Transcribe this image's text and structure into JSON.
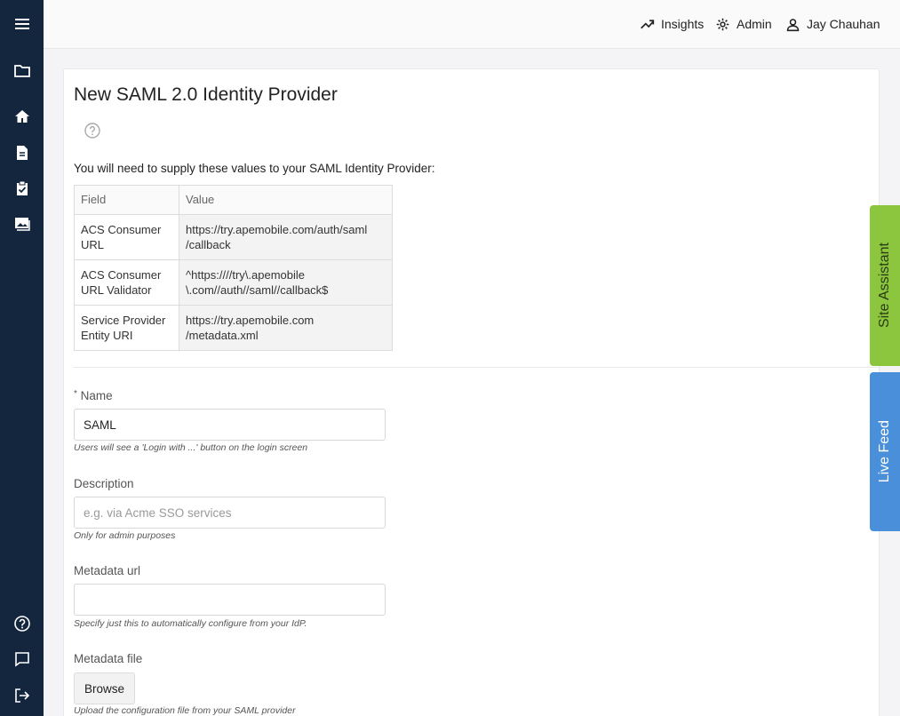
{
  "sidebar": {
    "items": [
      {
        "icon": "menu-icon"
      },
      {
        "icon": "folder-icon"
      },
      {
        "icon": "home-icon"
      },
      {
        "icon": "document-icon"
      },
      {
        "icon": "clipboard-check-icon"
      },
      {
        "icon": "images-icon"
      },
      {
        "icon": "help-circle-icon"
      },
      {
        "icon": "chat-icon"
      },
      {
        "icon": "logout-icon"
      }
    ]
  },
  "topbar": {
    "insights": "Insights",
    "admin": "Admin",
    "user": "Jay Chauhan"
  },
  "page": {
    "title": "New SAML 2.0 Identity Provider",
    "intro": "You will need to supply these values to your SAML Identity Provider:"
  },
  "table": {
    "headers": {
      "field": "Field",
      "value": "Value"
    },
    "rows": [
      {
        "field_l1": "ACS Consumer",
        "field_l2": "URL",
        "value_l1": "https://try.apemobile.com/auth/saml",
        "value_l2": "/callback"
      },
      {
        "field_l1": "ACS Consumer",
        "field_l2": "URL Validator",
        "value_l1": "^https:////try\\.apemobile",
        "value_l2": "\\.com//auth//saml//callback$"
      },
      {
        "field_l1": "Service Provider",
        "field_l2": "Entity URI",
        "value_l1": "https://try.apemobile.com",
        "value_l2": "/metadata.xml"
      }
    ]
  },
  "form": {
    "name": {
      "required_mark": "*",
      "label": "Name",
      "value": "SAML",
      "help": "Users will see a 'Login with ...' button on the login screen"
    },
    "description": {
      "label": "Description",
      "value": "",
      "placeholder": "e.g. via Acme SSO services",
      "help": "Only for admin purposes"
    },
    "metadata_url": {
      "label": "Metadata url",
      "value": "",
      "help": "Specify just this to automatically configure from your IdP."
    },
    "metadata_file": {
      "label": "Metadata file",
      "button": "Browse",
      "help": "Upload the configuration file from your SAML provider"
    }
  },
  "side_tabs": {
    "site_assistant": "Site Assistant",
    "live_feed": "Live Feed"
  },
  "colors": {
    "sidebar": "#14253e",
    "site_assistant_tab": "#8cc63f",
    "live_feed_tab": "#4a8fd9"
  }
}
